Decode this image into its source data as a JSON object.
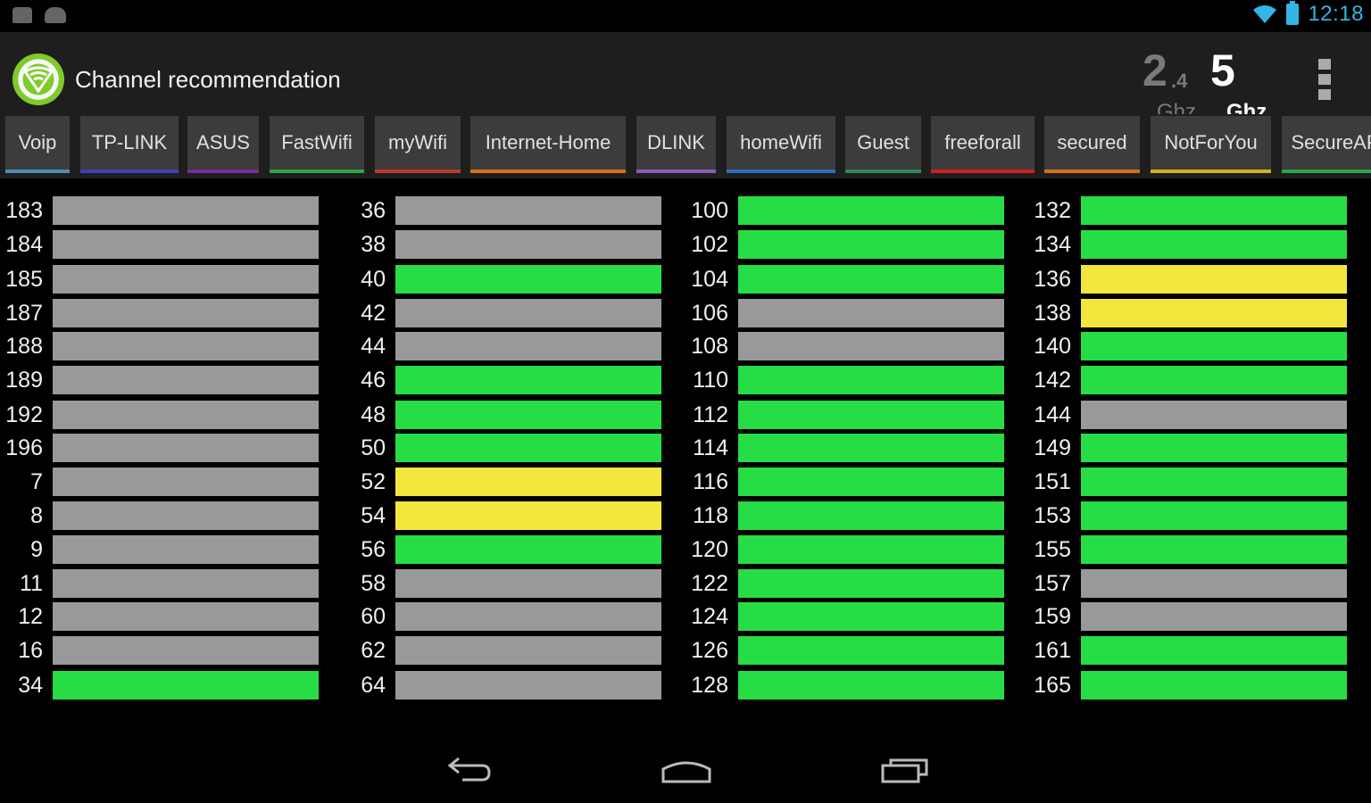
{
  "status_bar": {
    "time": "12:18",
    "icons": [
      "notification-icon",
      "gamepad-icon",
      "wifi-icon",
      "battery-icon"
    ],
    "accent_color": "#33b5e5"
  },
  "action_bar": {
    "title": "Channel recommendation",
    "band_24": {
      "number": "2",
      "sub": ".4",
      "unit": "Ghz",
      "selected": false
    },
    "band_5": {
      "number": "5",
      "unit": "Ghz",
      "selected": true
    },
    "menu_icon": "overflow-menu-icon"
  },
  "tabs": [
    {
      "label": "Voip",
      "color": "#4a8fb3"
    },
    {
      "label": "TP-LINK",
      "color": "#3f3fbf"
    },
    {
      "label": "ASUS",
      "color": "#7a2a9e"
    },
    {
      "label": "FastWifi",
      "color": "#2aa64a"
    },
    {
      "label": "myWifi",
      "color": "#c0392b"
    },
    {
      "label": "Internet-Home",
      "color": "#d4701c"
    },
    {
      "label": "DLINK",
      "color": "#8e5ab8"
    },
    {
      "label": "homeWifi",
      "color": "#2f6fbf"
    },
    {
      "label": "Guest",
      "color": "#2e8b57"
    },
    {
      "label": "freeforall",
      "color": "#d21f1f"
    },
    {
      "label": "secured",
      "color": "#d4701c"
    },
    {
      "label": "NotForYou",
      "color": "#d4b11c"
    },
    {
      "label": "SecureAP",
      "color": "#2aa64a"
    }
  ],
  "status_colors": {
    "good": "#27dd45",
    "fair": "#f3e63d",
    "none": "#999999"
  },
  "channel_columns": [
    [
      {
        "ch": "183",
        "status": "none"
      },
      {
        "ch": "184",
        "status": "none"
      },
      {
        "ch": "185",
        "status": "none"
      },
      {
        "ch": "187",
        "status": "none"
      },
      {
        "ch": "188",
        "status": "none"
      },
      {
        "ch": "189",
        "status": "none"
      },
      {
        "ch": "192",
        "status": "none"
      },
      {
        "ch": "196",
        "status": "none"
      },
      {
        "ch": "7",
        "status": "none"
      },
      {
        "ch": "8",
        "status": "none"
      },
      {
        "ch": "9",
        "status": "none"
      },
      {
        "ch": "11",
        "status": "none"
      },
      {
        "ch": "12",
        "status": "none"
      },
      {
        "ch": "16",
        "status": "none"
      },
      {
        "ch": "34",
        "status": "good"
      }
    ],
    [
      {
        "ch": "36",
        "status": "none"
      },
      {
        "ch": "38",
        "status": "none"
      },
      {
        "ch": "40",
        "status": "good"
      },
      {
        "ch": "42",
        "status": "none"
      },
      {
        "ch": "44",
        "status": "none"
      },
      {
        "ch": "46",
        "status": "good"
      },
      {
        "ch": "48",
        "status": "good"
      },
      {
        "ch": "50",
        "status": "good"
      },
      {
        "ch": "52",
        "status": "fair"
      },
      {
        "ch": "54",
        "status": "fair"
      },
      {
        "ch": "56",
        "status": "good"
      },
      {
        "ch": "58",
        "status": "none"
      },
      {
        "ch": "60",
        "status": "none"
      },
      {
        "ch": "62",
        "status": "none"
      },
      {
        "ch": "64",
        "status": "none"
      }
    ],
    [
      {
        "ch": "100",
        "status": "good"
      },
      {
        "ch": "102",
        "status": "good"
      },
      {
        "ch": "104",
        "status": "good"
      },
      {
        "ch": "106",
        "status": "none"
      },
      {
        "ch": "108",
        "status": "none"
      },
      {
        "ch": "110",
        "status": "good"
      },
      {
        "ch": "112",
        "status": "good"
      },
      {
        "ch": "114",
        "status": "good"
      },
      {
        "ch": "116",
        "status": "good"
      },
      {
        "ch": "118",
        "status": "good"
      },
      {
        "ch": "120",
        "status": "good"
      },
      {
        "ch": "122",
        "status": "good"
      },
      {
        "ch": "124",
        "status": "good"
      },
      {
        "ch": "126",
        "status": "good"
      },
      {
        "ch": "128",
        "status": "good"
      }
    ],
    [
      {
        "ch": "132",
        "status": "good"
      },
      {
        "ch": "134",
        "status": "good"
      },
      {
        "ch": "136",
        "status": "fair"
      },
      {
        "ch": "138",
        "status": "fair"
      },
      {
        "ch": "140",
        "status": "good"
      },
      {
        "ch": "142",
        "status": "good"
      },
      {
        "ch": "144",
        "status": "none"
      },
      {
        "ch": "149",
        "status": "good"
      },
      {
        "ch": "151",
        "status": "good"
      },
      {
        "ch": "153",
        "status": "good"
      },
      {
        "ch": "155",
        "status": "good"
      },
      {
        "ch": "157",
        "status": "none"
      },
      {
        "ch": "159",
        "status": "none"
      },
      {
        "ch": "161",
        "status": "good"
      },
      {
        "ch": "165",
        "status": "good"
      }
    ]
  ],
  "nav_bar": {
    "buttons": [
      "back-icon",
      "home-icon",
      "recent-apps-icon"
    ]
  }
}
